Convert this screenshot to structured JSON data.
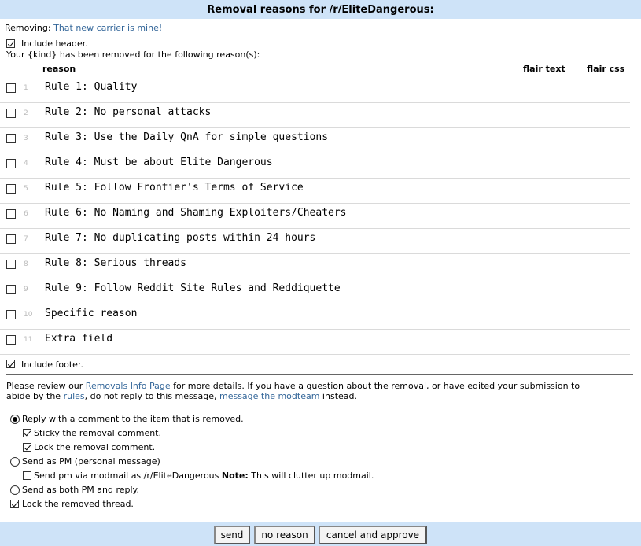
{
  "title": "Removal reasons for /r/EliteDangerous:",
  "removing": {
    "label": "Removing:",
    "link": "That new carrier is mine!"
  },
  "include_header": "Include header.",
  "header_text": "Your {kind} has been removed for the following reason(s):",
  "columns": {
    "reason": "reason",
    "flair_text": "flair text",
    "flair_css": "flair css"
  },
  "reasons": [
    {
      "num": "1",
      "label": "Rule 1: Quality"
    },
    {
      "num": "2",
      "label": "Rule 2: No personal attacks"
    },
    {
      "num": "3",
      "label": "Rule 3: Use the Daily QnA for simple questions"
    },
    {
      "num": "4",
      "label": "Rule 4: Must be about Elite Dangerous"
    },
    {
      "num": "5",
      "label": "Rule 5: Follow Frontier's Terms of Service"
    },
    {
      "num": "6",
      "label": "Rule 6: No Naming and Shaming Exploiters/Cheaters"
    },
    {
      "num": "7",
      "label": "Rule 7: No duplicating posts within 24 hours"
    },
    {
      "num": "8",
      "label": "Rule 8: Serious threads"
    },
    {
      "num": "9",
      "label": "Rule 9: Follow Reddit Site Rules and Reddiquette"
    },
    {
      "num": "10",
      "label": "Specific reason"
    },
    {
      "num": "11",
      "label": "Extra field"
    }
  ],
  "include_footer": "Include footer.",
  "footer": {
    "p1": "Please review our ",
    "link1": "Removals Info Page",
    "p2": " for more details. If you have a question about the removal, or have edited your submission to",
    "p3": "abide by the ",
    "link2": "rules",
    "p4": ", do not reply to this message, ",
    "link3": "message the modteam",
    "p5": " instead."
  },
  "options": {
    "reply_comment": "Reply with a comment to the item that is removed.",
    "sticky": "Sticky the removal comment.",
    "lock_comment": "Lock the removal comment.",
    "send_pm": "Send as PM (personal message)",
    "modmail_a": "Send pm via modmail as /r/EliteDangerous ",
    "modmail_note": "Note:",
    "modmail_b": " This will clutter up modmail.",
    "both": "Send as both PM and reply.",
    "lock_thread": "Lock the removed thread."
  },
  "buttons": {
    "send": "send",
    "no_reason": "no reason",
    "cancel": "cancel and approve"
  },
  "colors": {
    "header_bg": "#cee3f8",
    "link": "#336699"
  }
}
